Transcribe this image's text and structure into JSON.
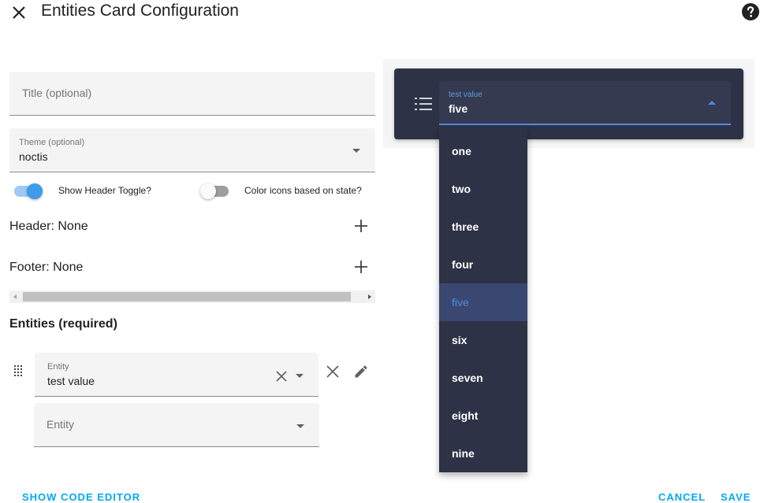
{
  "dialog": {
    "title": "Entities Card Configuration"
  },
  "form": {
    "title_placeholder": "Title (optional)",
    "theme_label": "Theme (optional)",
    "theme_value": "noctis",
    "show_header_toggle_label": "Show Header Toggle?",
    "show_header_toggle_on": true,
    "color_icons_label": "Color icons based on state?",
    "color_icons_on": false,
    "header_text": "Header: None",
    "footer_text": "Footer: None",
    "entities_heading": "Entities (required)",
    "entity_rows": [
      {
        "label": "Entity",
        "value": "test value"
      },
      {
        "placeholder": "Entity"
      }
    ]
  },
  "actions": {
    "show_code_editor": "SHOW CODE EDITOR",
    "cancel": "CANCEL",
    "save": "SAVE"
  },
  "preview": {
    "select_label": "test value",
    "select_value": "five",
    "options": [
      "one",
      "two",
      "three",
      "four",
      "five",
      "six",
      "seven",
      "eight",
      "nine"
    ],
    "selected_option": "five"
  },
  "colors": {
    "accent": "#03a9f4",
    "card_bg": "#2e3246",
    "select_accent": "#4d8de0",
    "switch_on": "#3d9be9"
  },
  "icons": [
    "close-icon",
    "help-icon",
    "plus-icon",
    "drag-handle-icon",
    "edit-icon",
    "list-icon",
    "chevron-down-icon",
    "chevron-up-icon"
  ]
}
